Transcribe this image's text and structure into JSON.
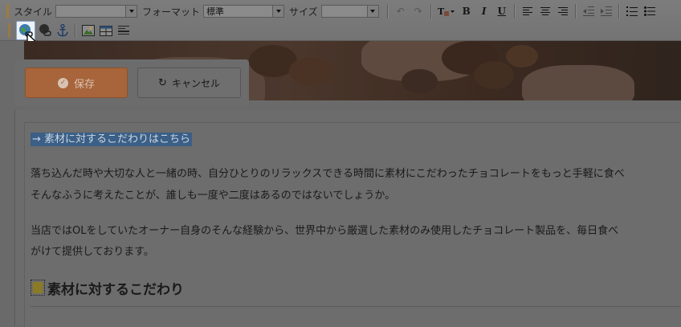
{
  "toolbar": {
    "style_label": "スタイル",
    "style_value": "",
    "format_label": "フォーマット",
    "format_value": "標準",
    "size_label": "サイズ",
    "size_value": ""
  },
  "actions": {
    "save_label": "保存",
    "cancel_label": "キャンセル"
  },
  "content": {
    "link_text": "→ 素材に対するこだわりはこちら",
    "paragraph1_line1": "落ち込んだ時や大切な人と一緒の時、自分ひとりのリラックスできる時間に素材にこだわったチョコレートをもっと手軽に食べ",
    "paragraph1_line2": "そんなふうに考えたことが、誰しも一度や二度はあるのではないでしょうか。",
    "paragraph2_line1": "当店ではOLをしていたオーナー自身のそんな経験から、世界中から厳選した素材のみ使用したチョコレート製品を、毎日食べ",
    "paragraph2_line2": "がけて提供しております。",
    "heading": "素材に対するこだわり"
  }
}
